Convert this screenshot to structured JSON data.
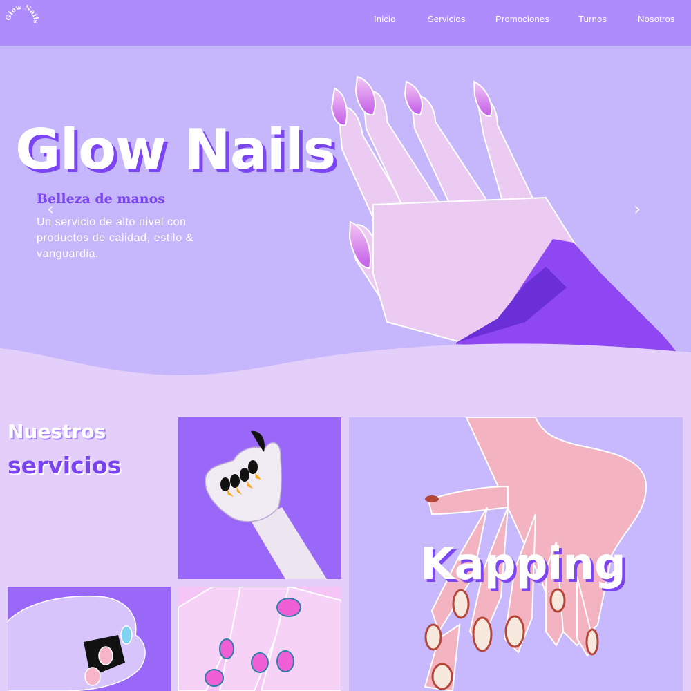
{
  "navbar": {
    "logo_text": "Glow Nails",
    "links": [
      "Inicio",
      "Servicios",
      "Promociones",
      "Turnos",
      "Nosotros"
    ]
  },
  "hero": {
    "title": "Glow Nails",
    "subtitle": "Belleza de manos",
    "description": "Un servicio de alto nivel con productos de calidad, estilo & vanguardia.",
    "prev_arrow": "‹",
    "next_arrow": "›"
  },
  "services": {
    "title_line1": "Nuestros",
    "title_line2": "servicios",
    "featured_label": "Kapping"
  },
  "colors": {
    "navbar": "#af8cfb",
    "hero_bg": "#c6b6fc",
    "page_bg": "#e4cffb",
    "accent": "#7c45f2"
  },
  "icons": [
    "chevron-left-icon",
    "chevron-right-icon"
  ]
}
